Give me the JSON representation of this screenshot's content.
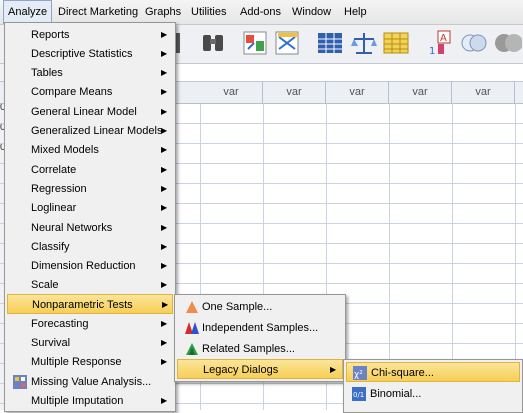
{
  "menubar": {
    "items": [
      {
        "label": "Analyze",
        "active": true
      },
      {
        "label": "Direct Marketing"
      },
      {
        "label": "Graphs"
      },
      {
        "label": "Utilities"
      },
      {
        "label": "Add-ons"
      },
      {
        "label": "Window"
      },
      {
        "label": "Help"
      }
    ]
  },
  "grid": {
    "column_headers": [
      "var",
      "var",
      "var",
      "var",
      "var"
    ],
    "row_fragments": [
      "0",
      "0",
      "0"
    ]
  },
  "analyze_menu": {
    "items": [
      {
        "label": "Reports",
        "submenu": true
      },
      {
        "label": "Descriptive Statistics",
        "submenu": true
      },
      {
        "label": "Tables",
        "submenu": true
      },
      {
        "label": "Compare Means",
        "submenu": true
      },
      {
        "label": "General Linear Model",
        "submenu": true
      },
      {
        "label": "Generalized Linear Models",
        "submenu": true
      },
      {
        "label": "Mixed Models",
        "submenu": true
      },
      {
        "label": "Correlate",
        "submenu": true
      },
      {
        "label": "Regression",
        "submenu": true
      },
      {
        "label": "Loglinear",
        "submenu": true
      },
      {
        "label": "Neural Networks",
        "submenu": true
      },
      {
        "label": "Classify",
        "submenu": true
      },
      {
        "label": "Dimension Reduction",
        "submenu": true
      },
      {
        "label": "Scale",
        "submenu": true
      },
      {
        "label": "Nonparametric Tests",
        "submenu": true,
        "highlighted": true
      },
      {
        "label": "Forecasting",
        "submenu": true
      },
      {
        "label": "Survival",
        "submenu": true
      },
      {
        "label": "Multiple Response",
        "submenu": true
      },
      {
        "label": "Missing Value Analysis...",
        "submenu": false,
        "icon": "missing-value-icon"
      },
      {
        "label": "Multiple Imputation",
        "submenu": true
      }
    ]
  },
  "nonparametric_menu": {
    "items": [
      {
        "label": "One Sample...",
        "icon": "one-sample-icon"
      },
      {
        "label": "Independent Samples...",
        "icon": "independent-samples-icon"
      },
      {
        "label": "Related Samples...",
        "icon": "related-samples-icon"
      },
      {
        "label": "Legacy Dialogs",
        "submenu": true,
        "highlighted": true
      }
    ]
  },
  "legacy_menu": {
    "items": [
      {
        "label": "Chi-square...",
        "icon": "chi-square-icon",
        "highlighted": true
      },
      {
        "label": "Binomial...",
        "icon": "binomial-icon"
      }
    ]
  },
  "colors": {
    "highlight": "#f7cf55",
    "menu_bg": "#f0f0f0",
    "grid_line": "#c9d3e2"
  }
}
